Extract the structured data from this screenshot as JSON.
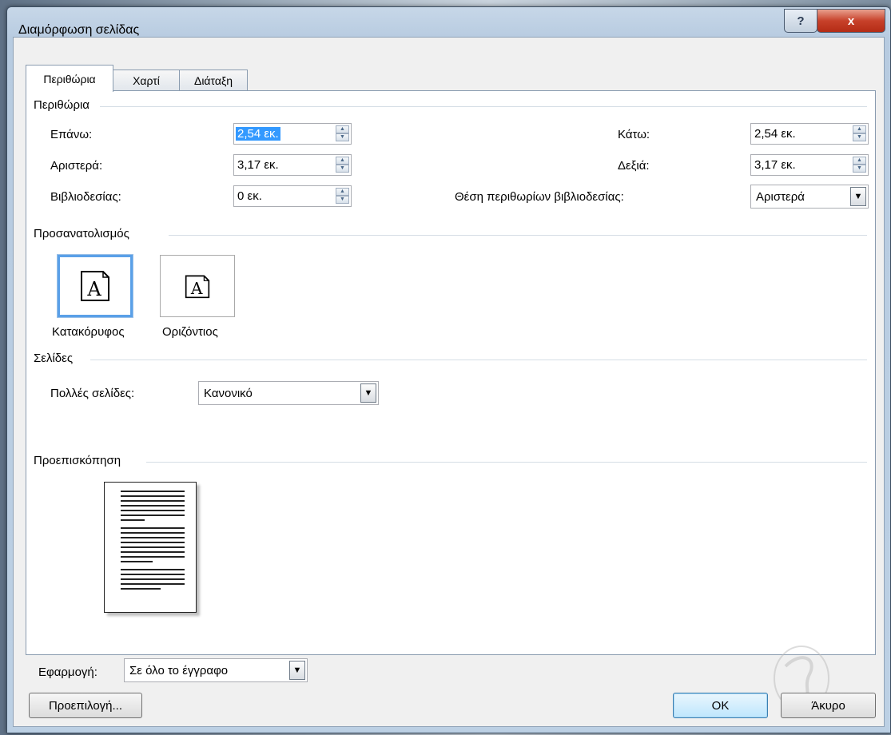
{
  "window": {
    "title": "Διαμόρφωση σελίδας",
    "help_glyph": "?",
    "close_glyph": "x"
  },
  "tabs": [
    {
      "label": "Περιθώρια",
      "active": true
    },
    {
      "label": "Χαρτί",
      "active": false
    },
    {
      "label": "Διάταξη",
      "active": false
    }
  ],
  "margins": {
    "heading": "Περιθώρια",
    "top_label": "Επάνω:",
    "top_value": "2,54 εκ.",
    "bottom_label": "Κάτω:",
    "bottom_value": "2,54 εκ.",
    "left_label": "Αριστερά:",
    "left_value": "3,17 εκ.",
    "right_label": "Δεξιά:",
    "right_value": "3,17 εκ.",
    "gutter_label": "Βιβλιοδεσίας:",
    "gutter_value": "0 εκ.",
    "gutter_pos_label": "Θέση περιθωρίων βιβλιοδεσίας:",
    "gutter_pos_value": "Αριστερά"
  },
  "orientation": {
    "heading": "Προσανατολισμός",
    "portrait_label": "Κατακόρυφος",
    "landscape_label": "Οριζόντιος",
    "icon_letter": "A",
    "selected": "portrait"
  },
  "pages": {
    "heading": "Σελίδες",
    "multiple_label": "Πολλές σελίδες:",
    "multiple_value": "Κανονικό"
  },
  "preview": {
    "heading": "Προεπισκόπηση"
  },
  "apply": {
    "label": "Εφαρμογή:",
    "value": "Σε όλο το έγγραφο"
  },
  "buttons": {
    "default_label": "Προεπιλογή...",
    "ok_label": "OK",
    "cancel_label": "Άκυρο"
  },
  "colors": {
    "selection": "#3399ff",
    "titlebar": "#b7cbe0",
    "close": "#c7412a"
  }
}
